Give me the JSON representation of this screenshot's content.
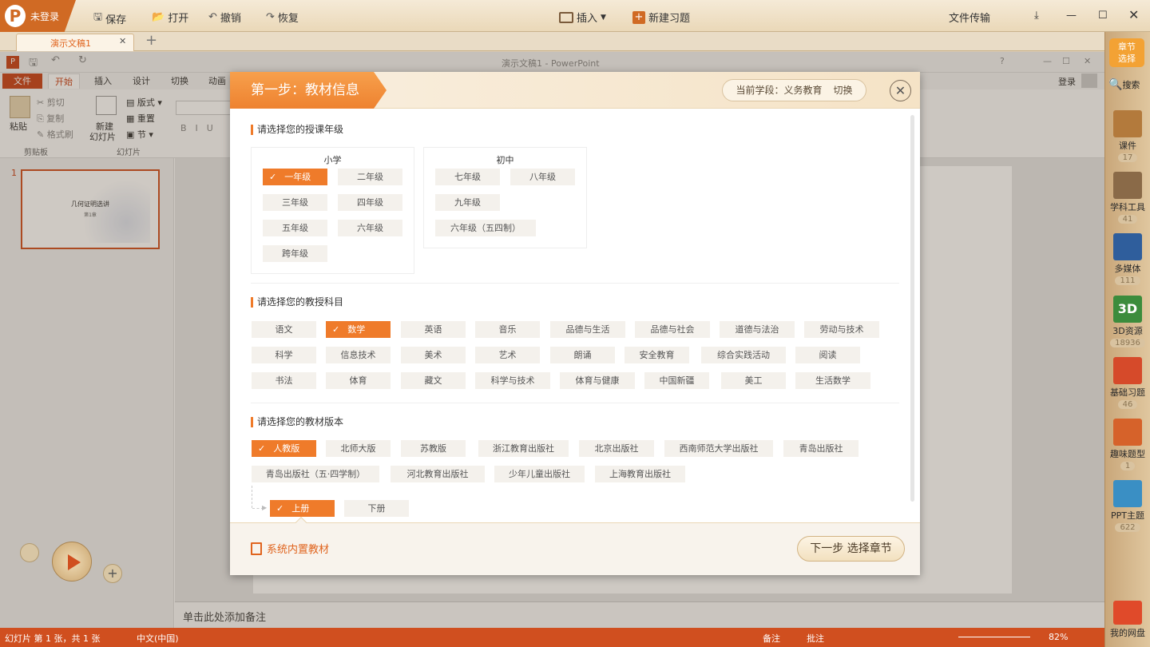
{
  "topbar": {
    "logo_text": "未登录",
    "save": "保存",
    "open": "打开",
    "undo": "撤销",
    "redo": "恢复",
    "insert": "插入",
    "new_exercise": "新建习题",
    "file_transfer": "文件传输"
  },
  "doc_tab": {
    "label": "演示文稿1"
  },
  "ppt": {
    "window_title": "演示文稿1 - PowerPoint",
    "login": "登录",
    "tabs": [
      "文件",
      "开始",
      "插入",
      "设计",
      "切换",
      "动画"
    ],
    "ribbon": {
      "paste": "粘贴",
      "cut": "剪切",
      "copy": "复制",
      "format_painter": "格式刷",
      "clipboard": "剪贴板",
      "new_slide": "新建",
      "new_slide2": "幻灯片",
      "layout": "版式",
      "reset": "重置",
      "section": "节",
      "slides_group": "幻灯片"
    },
    "slide_number": "1",
    "thumb_title": "几何证明选讲",
    "thumb_sub": "第1章",
    "notes": "单击此处添加备注",
    "status": {
      "slide_info": "幻灯片 第 1 张，共 1 张",
      "lang": "中文(中国)",
      "notes": "备注",
      "comments": "批注",
      "zoom": "82%"
    }
  },
  "right_panel": {
    "top": {
      "line1": "章节",
      "line2": "选择"
    },
    "search": "搜索",
    "items": [
      {
        "label": "课件",
        "count": "17"
      },
      {
        "label": "学科工具",
        "count": "41"
      },
      {
        "label": "多媒体",
        "count": "111"
      },
      {
        "label": "3D资源",
        "count": "18936"
      },
      {
        "label": "基础习题",
        "count": "46"
      },
      {
        "label": "趣味题型",
        "count": "1"
      },
      {
        "label": "PPT主题",
        "count": "622"
      }
    ],
    "cloud": "我的网盘"
  },
  "dialog": {
    "step_title": "第一步：教材信息",
    "stage_prefix": "当前学段：义务教育",
    "stage_switch": "切换",
    "grade_section": "请选择您的授课年级",
    "primary_title": "小学",
    "primary_grades": [
      "一年级",
      "二年级",
      "三年级",
      "四年级",
      "五年级",
      "六年级",
      "跨年级"
    ],
    "junior_title": "初中",
    "junior_grades": [
      "七年级",
      "八年级",
      "九年级",
      "六年级（五四制）"
    ],
    "subject_section": "请选择您的教授科目",
    "subjects": [
      [
        "语文",
        "数学",
        "英语",
        "音乐",
        "品德与生活",
        "品德与社会",
        "道德与法治",
        "劳动与技术"
      ],
      [
        "科学",
        "信息技术",
        "美术",
        "艺术",
        "朗诵",
        "安全教育",
        "综合实践活动",
        "阅读"
      ],
      [
        "书法",
        "体育",
        "藏文",
        "科学与技术",
        "体育与健康",
        "中国新疆",
        "美工",
        "生活数学"
      ]
    ],
    "edition_section": "请选择您的教材版本",
    "editions": [
      [
        "人教版",
        "北师大版",
        "苏教版",
        "浙江教育出版社",
        "北京出版社",
        "西南师范大学出版社",
        "青岛出版社"
      ],
      [
        "青岛出版社（五·四学制）",
        "河北教育出版社",
        "少年儿童出版社",
        "上海教育出版社"
      ]
    ],
    "volumes": [
      "上册",
      "下册"
    ],
    "builtin": "系统内置教材",
    "next_button": "下一步 选择章节"
  }
}
